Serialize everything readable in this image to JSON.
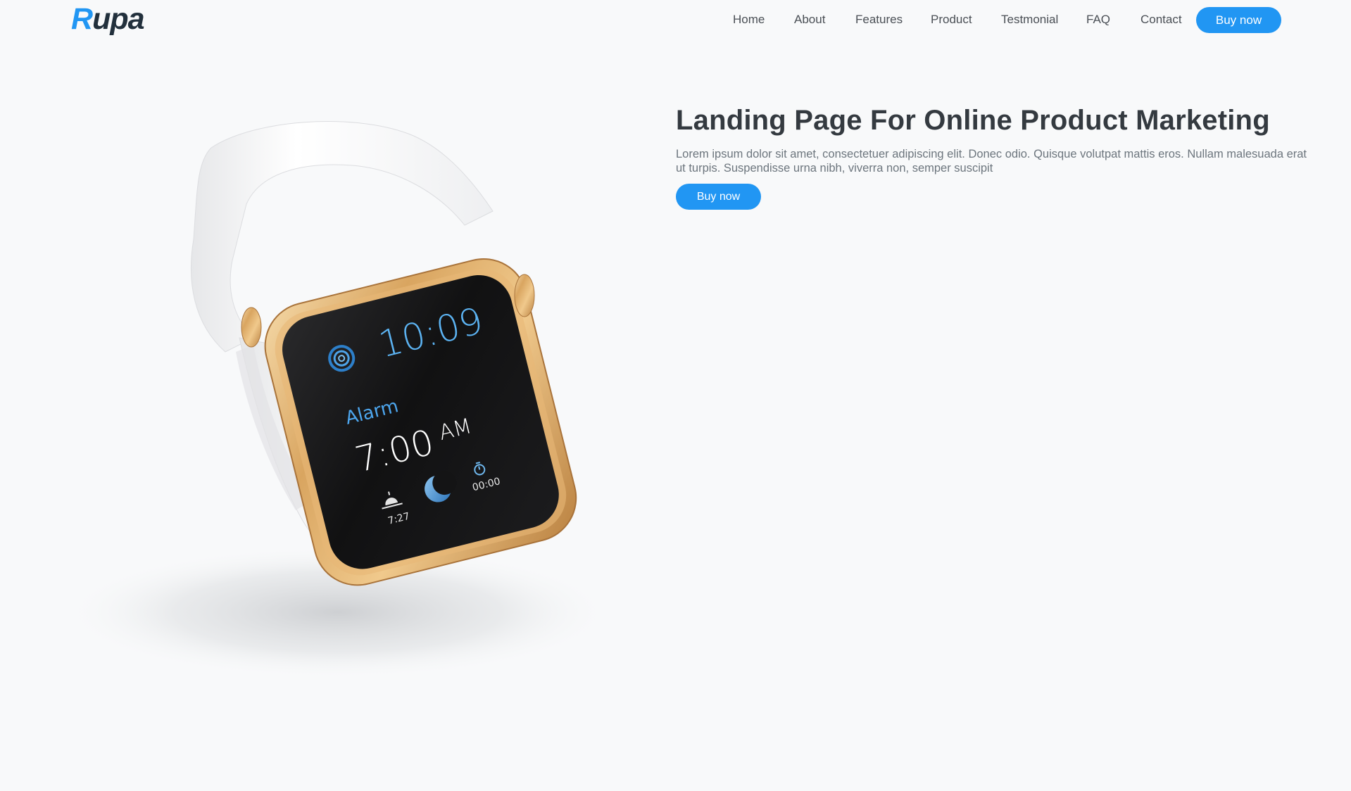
{
  "brand": {
    "first_letter": "R",
    "rest": "upa"
  },
  "nav": {
    "links": [
      "Home",
      "About",
      "Features",
      "Product",
      "Testmonial",
      "FAQ",
      "Contact"
    ],
    "cta": "Buy now"
  },
  "hero": {
    "title": "Landing Page For Online Product Marketing",
    "description": "Lorem ipsum dolor sit amet, consectetuer adipiscing elit. Donec odio. Quisque volutpat mattis eros. Nullam malesuada erat ut turpis. Suspendisse urna nibh, viverra non, semper suscipit",
    "cta": "Buy now"
  },
  "watch_screen": {
    "time": "10:09",
    "alarm_label": "Alarm",
    "alarm_time": "7:00",
    "alarm_period": "AM",
    "sunrise_time": "7:27",
    "timer": "00:00"
  },
  "colors": {
    "accent": "#2196f3",
    "background": "#f8f9fa",
    "text_dark": "#343a40",
    "text_muted": "#6c757d"
  }
}
